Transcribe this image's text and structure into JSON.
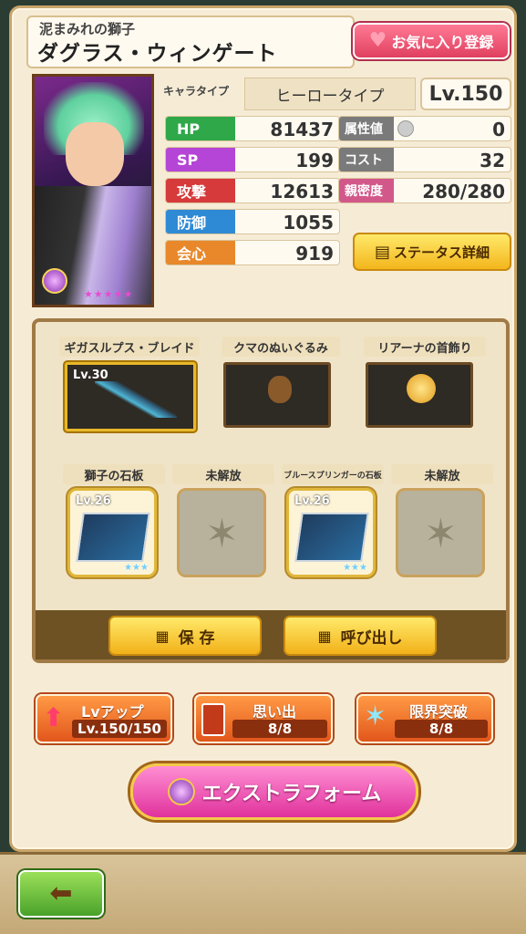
{
  "header": {
    "subtitle": "泥まみれの獅子",
    "name": "ダグラス・ウィンゲート",
    "favorite_button": "お気に入り登録"
  },
  "character": {
    "type_label": "キャラタイプ",
    "type_value": "ヒーロータイプ",
    "level": "Lv.150",
    "rarity_stars": "★★★★★"
  },
  "stats_left": [
    {
      "label": "HP",
      "value": "81437",
      "color": "#2fa84a"
    },
    {
      "label": "SP",
      "value": "199",
      "color": "#b545d6"
    },
    {
      "label": "攻撃",
      "value": "12613",
      "color": "#d63a3a"
    },
    {
      "label": "防御",
      "value": "1055",
      "color": "#2f8ad6"
    },
    {
      "label": "会心",
      "value": "919",
      "color": "#e8882a"
    }
  ],
  "stats_right": [
    {
      "label": "属性値",
      "value": "0",
      "color": "#7a7a7a"
    },
    {
      "label": "コスト",
      "value": "32",
      "color": "#7a7a7a"
    },
    {
      "label": "親密度",
      "value": "280/280",
      "color": "#d2588a"
    }
  ],
  "status_detail_button": "ステータス詳細",
  "equipment": [
    {
      "name": "ギガスルプス・ブレイド",
      "level": "Lv.30"
    },
    {
      "name": "クマのぬいぐるみ",
      "level": ""
    },
    {
      "name": "リアーナの首飾り",
      "level": ""
    }
  ],
  "plates": [
    {
      "name": "獅子の石板",
      "level": "Lv.26",
      "stars": "★★★"
    },
    {
      "name": "未解放",
      "level": "",
      "stars": ""
    },
    {
      "name": "ブルースプリンガーの石板",
      "level": "Lv.26",
      "stars": "★★★"
    },
    {
      "name": "未解放",
      "level": "",
      "stars": ""
    }
  ],
  "actions": {
    "save": "保 存",
    "recall": "呼び出し"
  },
  "bottom_buttons": {
    "levelup": {
      "title": "Lvアップ",
      "value": "Lv.150/150"
    },
    "memory": {
      "title": "思い出",
      "value": "8/8"
    },
    "limit_break": {
      "title": "限界突破",
      "value": "8/8"
    }
  },
  "extra_form": "エクストラフォーム",
  "colors": {
    "frame": "#f6ecd6",
    "accent_pink": "#e0405f",
    "gold": "#f2b119"
  }
}
